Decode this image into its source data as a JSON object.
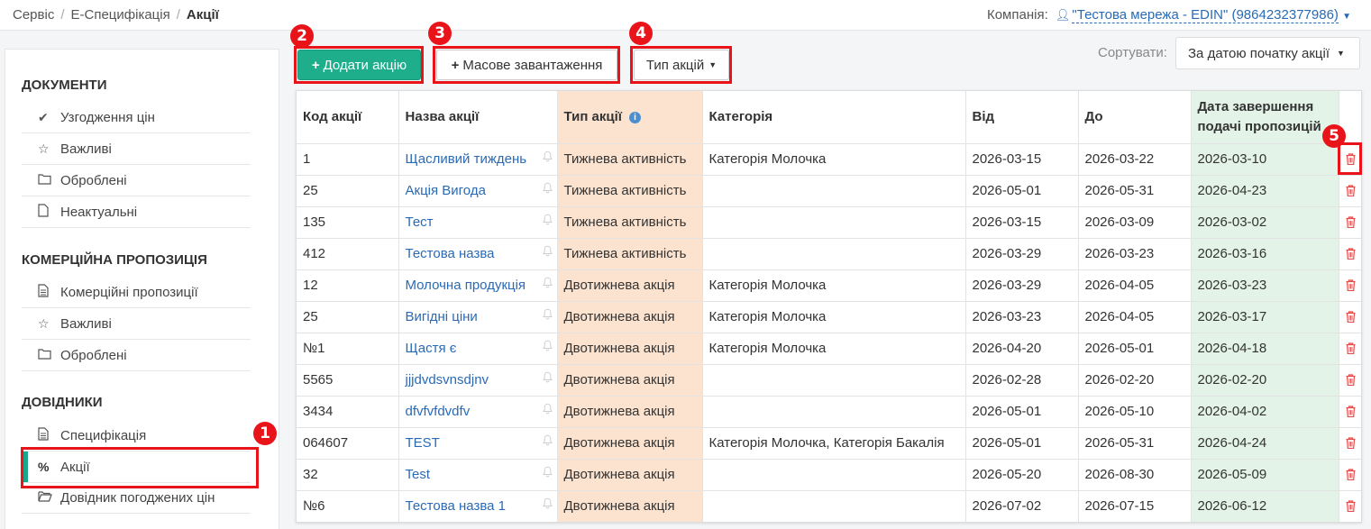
{
  "breadcrumb": {
    "items": [
      "Сервіс",
      "Е-Специфікація"
    ],
    "active": "Акції"
  },
  "company": {
    "label": "Компанія:",
    "value": "\"Тестова мережа - EDIN\" (9864232377986)"
  },
  "sidebar": {
    "sections": [
      {
        "title": "ДОКУМЕНТИ",
        "items": [
          {
            "label": "Узгодження цін",
            "icon": "check-icon"
          },
          {
            "label": "Важливі",
            "icon": "star-icon"
          },
          {
            "label": "Оброблені",
            "icon": "folder-icon"
          },
          {
            "label": "Неактуальні",
            "icon": "file-icon"
          }
        ]
      },
      {
        "title": "КОМЕРЦІЙНА ПРОПОЗИЦІЯ",
        "items": [
          {
            "label": "Комерційні пропозиції",
            "icon": "document-icon"
          },
          {
            "label": "Важливі",
            "icon": "star-icon"
          },
          {
            "label": "Оброблені",
            "icon": "folder-icon"
          }
        ]
      },
      {
        "title": "ДОВІДНИКИ",
        "items": [
          {
            "label": "Специфікація",
            "icon": "document-icon"
          },
          {
            "label": "Акції",
            "icon": "percent-icon"
          },
          {
            "label": "Довідник погоджених цін",
            "icon": "folder-open-icon"
          }
        ]
      }
    ]
  },
  "toolbar": {
    "add_label": "Додати акцію",
    "mass_label": "Масове завантаження",
    "type_label": "Тип акцій",
    "sort_label": "Сортувати:",
    "sort_value": "За датою початку акції"
  },
  "callouts": [
    "1",
    "2",
    "3",
    "4",
    "5"
  ],
  "table": {
    "headers": [
      "Код акції",
      "Назва акції",
      "Тип акції",
      "Категорія",
      "Від",
      "До",
      "Дата завершення подачі пропозицій"
    ],
    "rows": [
      [
        "1",
        "Щасливий тиждень",
        "Тижнева активність",
        "Категорія Молочка",
        "2026-03-15",
        "2026-03-22",
        "2026-03-10"
      ],
      [
        "25",
        "Акція Вигода",
        "Тижнева активність",
        "",
        "2026-05-01",
        "2026-05-31",
        "2026-04-23"
      ],
      [
        "135",
        "Тест",
        "Тижнева активність",
        "",
        "2026-03-15",
        "2026-03-09",
        "2026-03-02"
      ],
      [
        "412",
        "Тестова назва",
        "Тижнева активність",
        "",
        "2026-03-29",
        "2026-03-23",
        "2026-03-16"
      ],
      [
        "12",
        "Молочна продукція",
        "Двотижнева акція",
        "Категорія Молочка",
        "2026-03-29",
        "2026-04-05",
        "2026-03-23"
      ],
      [
        "25",
        "Вигідні ціни",
        "Двотижнева акція",
        "Категорія Молочка",
        "2026-03-23",
        "2026-04-05",
        "2026-03-17"
      ],
      [
        "№1",
        "Щастя є",
        "Двотижнева акція",
        "Категорія Молочка",
        "2026-04-20",
        "2026-05-01",
        "2026-04-18"
      ],
      [
        "5565",
        "jjjdvdsvnsdjnv",
        "Двотижнева акція",
        "",
        "2026-02-28",
        "2026-02-20",
        "2026-02-20"
      ],
      [
        "3434",
        "dfvfvfdvdfv",
        "Двотижнева акція",
        "",
        "2026-05-01",
        "2026-05-10",
        "2026-04-02"
      ],
      [
        "064607",
        "TEST",
        "Двотижнева акція",
        "Категорія Молочка, Категорія Бакалія",
        "2026-05-01",
        "2026-05-31",
        "2026-04-24"
      ],
      [
        "32",
        "Test",
        "Двотижнева акція",
        "",
        "2026-05-20",
        "2026-08-30",
        "2026-05-09"
      ],
      [
        "№6",
        "Тестова назва 1",
        "Двотижнева акція",
        "",
        "2026-07-02",
        "2026-07-15",
        "2026-06-12"
      ]
    ]
  },
  "colors": {
    "accent": "#1fae8c",
    "link": "#2a6ab5",
    "highlight": "#e8141a",
    "type_col": "#fbe3d0",
    "deadline_col": "#e3f3e7",
    "trash": "#e44c4c"
  }
}
